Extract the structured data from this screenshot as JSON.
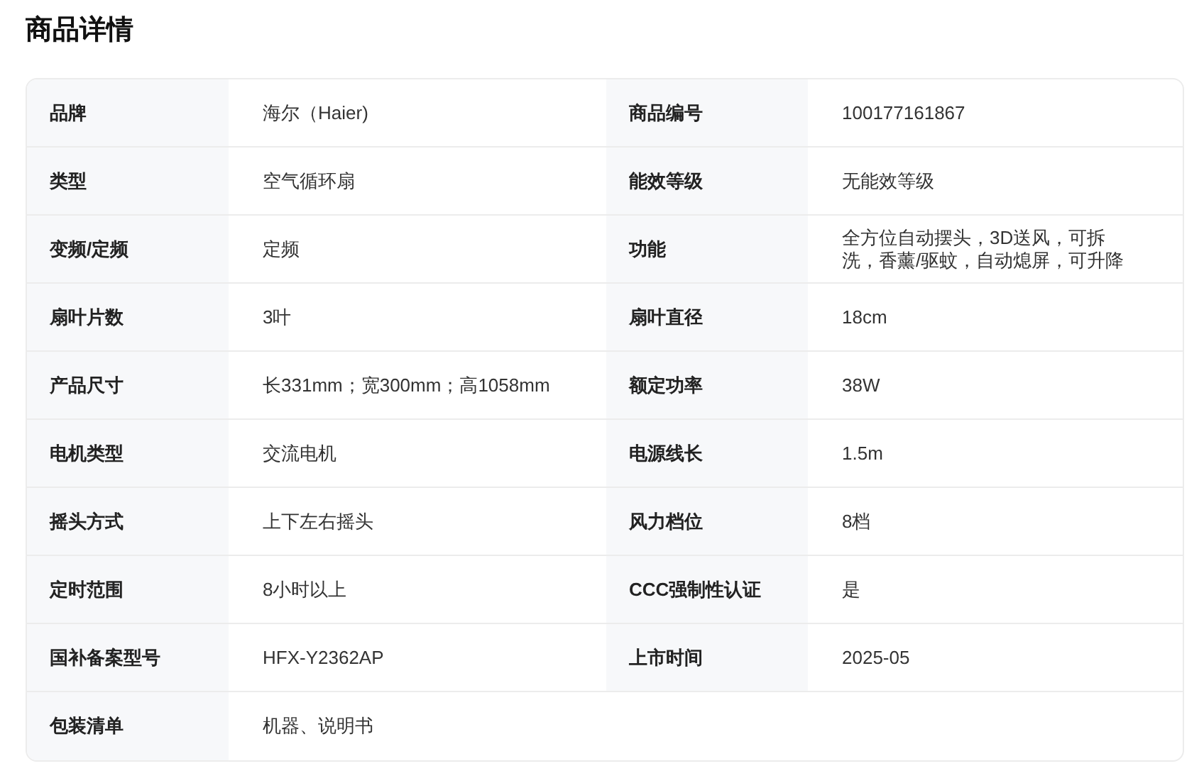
{
  "title": "商品详情",
  "rows": [
    [
      {
        "label": "品牌",
        "value": "海尔（Haier)"
      },
      {
        "label": "商品编号",
        "value": "100177161867"
      }
    ],
    [
      {
        "label": "类型",
        "value": "空气循环扇"
      },
      {
        "label": "能效等级",
        "value": "无能效等级"
      }
    ],
    [
      {
        "label": "变频/定频",
        "value": "定频"
      },
      {
        "label": "功能",
        "value": "全方位自动摆头，3D送风，可拆洗，香薰/驱蚊，自动熄屏，可升降"
      }
    ],
    [
      {
        "label": "扇叶片数",
        "value": "3叶"
      },
      {
        "label": "扇叶直径",
        "value": "18cm"
      }
    ],
    [
      {
        "label": "产品尺寸",
        "value": "长331mm；宽300mm；高1058mm"
      },
      {
        "label": "额定功率",
        "value": "38W"
      }
    ],
    [
      {
        "label": "电机类型",
        "value": "交流电机"
      },
      {
        "label": "电源线长",
        "value": "1.5m"
      }
    ],
    [
      {
        "label": "摇头方式",
        "value": "上下左右摇头"
      },
      {
        "label": "风力档位",
        "value": "8档"
      }
    ],
    [
      {
        "label": "定时范围",
        "value": "8小时以上"
      },
      {
        "label": "CCC强制性认证",
        "value": "是"
      }
    ],
    [
      {
        "label": "国补备案型号",
        "value": "HFX-Y2362AP"
      },
      {
        "label": "上市时间",
        "value": "2025-05"
      }
    ],
    [
      {
        "label": "包装清单",
        "value": "机器、说明书"
      }
    ]
  ]
}
